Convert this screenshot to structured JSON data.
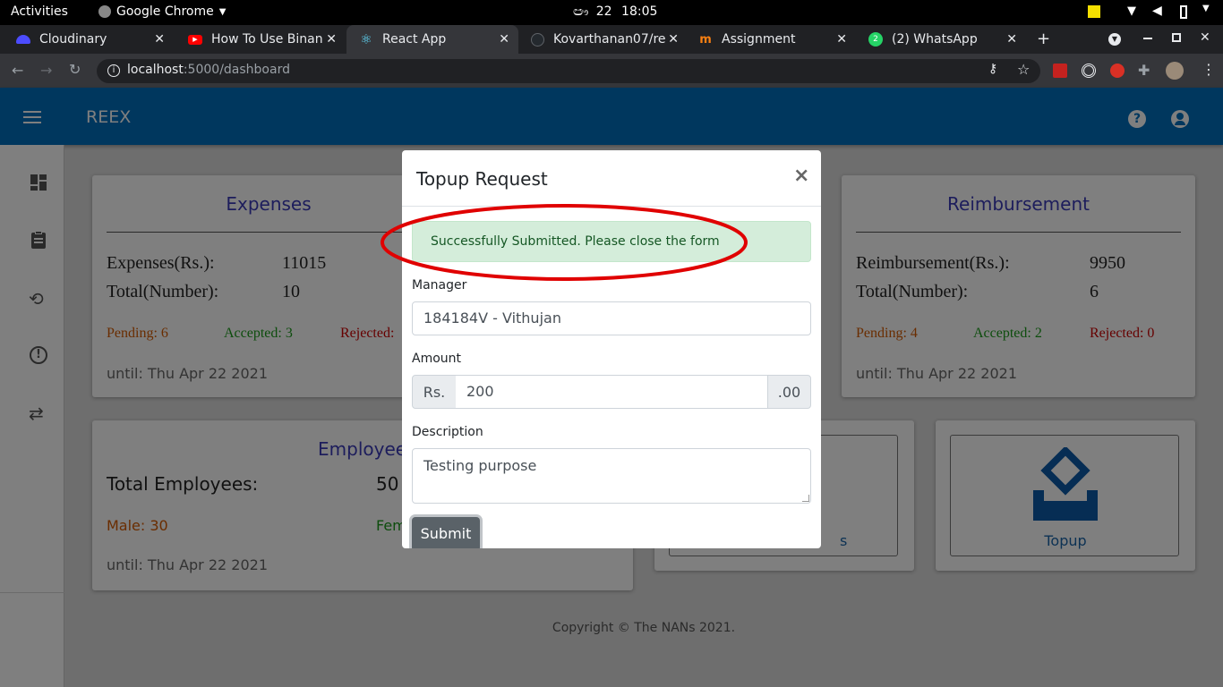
{
  "os_bar": {
    "activities": "Activities",
    "app": "Google Chrome",
    "date": "22",
    "time": "18:05"
  },
  "browser": {
    "tabs": [
      {
        "label": "Cloudinary",
        "icon": "cloudinary-icon",
        "color": "#4c4cff"
      },
      {
        "label": "How To Use Binan",
        "icon": "youtube-icon",
        "color": "#ff0000"
      },
      {
        "label": "React App",
        "icon": "react-icon",
        "color": "#61dafb"
      },
      {
        "label": "Kovarthanan07/re",
        "icon": "github-icon",
        "color": "#24292e"
      },
      {
        "label": "Assignment",
        "icon": "moodle-icon",
        "color": "#f98012"
      },
      {
        "label": "(2) WhatsApp",
        "icon": "whatsapp-icon",
        "color": "#25d366"
      }
    ],
    "url_host": "localhost",
    "url_path": ":5000/dashboard"
  },
  "app": {
    "title": "REEX"
  },
  "cards": {
    "expenses": {
      "title": "Expenses",
      "amount_label": "Expenses(Rs.):",
      "amount": "11015",
      "count_label": "Total(Number):",
      "count": "10",
      "pending": "Pending: 6",
      "accepted": "Accepted: 3",
      "rejected": "Rejected:",
      "until": "until: Thu Apr 22 2021"
    },
    "reimbursement": {
      "title": "Reimbursement",
      "amount_label": "Reimbursement(Rs.):",
      "amount": "9950",
      "count_label": "Total(Number):",
      "count": "6",
      "pending": "Pending: 4",
      "accepted": "Accepted: 2",
      "rejected": "Rejected: 0",
      "until": "until: Thu Apr 22 2021"
    },
    "employees": {
      "title": "Employees",
      "total_label": "Total Employees:",
      "total": "50",
      "male": "Male: 30",
      "female": "Fem",
      "until": "until: Thu Apr 22 2021"
    },
    "shortcut_partial": "s",
    "topup": {
      "label": "Topup"
    }
  },
  "footer": "Copyright © The NANs 2021.",
  "modal": {
    "title": "Topup Request",
    "close": "×",
    "alert": "Successfully Submitted. Please close the form",
    "manager_label": "Manager",
    "manager_value": "184184V - Vithujan",
    "amount_label": "Amount",
    "currency": "Rs.",
    "amount_value": "200",
    "cents": ".00",
    "description_label": "Description",
    "description_value": "Testing purpose",
    "submit": "Submit"
  },
  "colors": {
    "primary": "#006ebd",
    "pending": "#d45a00",
    "accepted": "#1a9a1a",
    "rejected": "#cc0000",
    "annotation": "#e00000"
  }
}
